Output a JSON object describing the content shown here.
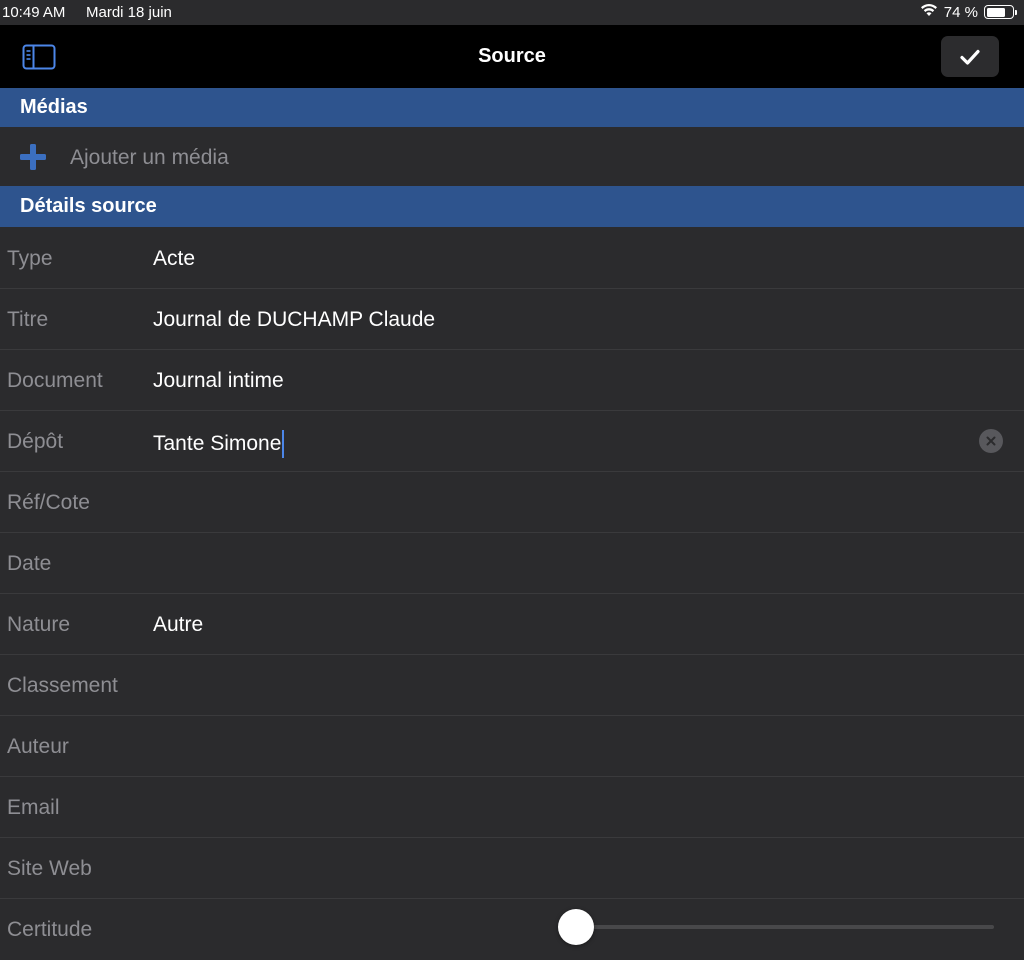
{
  "status_bar": {
    "time": "10:49 AM",
    "date": "Mardi 18 juin",
    "battery": "74 %",
    "battery_level": 74,
    "wifi_icon": "wifi-icon"
  },
  "nav": {
    "title": "Source",
    "sidebar_icon": "sidebar-icon",
    "done_icon": "checkmark-icon"
  },
  "media": {
    "header": "Médias",
    "add_label": "Ajouter un média",
    "add_icon": "plus-icon"
  },
  "details": {
    "header": "Détails source",
    "fields": [
      {
        "label": "Type",
        "value": "Acte"
      },
      {
        "label": "Titre",
        "value": "Journal de DUCHAMP Claude"
      },
      {
        "label": "Document",
        "value": "Journal intime"
      },
      {
        "label": "Dépôt",
        "value": "Tante Simone"
      },
      {
        "label": "Réf/Cote",
        "value": ""
      },
      {
        "label": "Date",
        "value": ""
      },
      {
        "label": "Nature",
        "value": "Autre"
      },
      {
        "label": "Classement",
        "value": ""
      },
      {
        "label": "Auteur",
        "value": ""
      },
      {
        "label": "Email",
        "value": ""
      },
      {
        "label": "Site Web",
        "value": ""
      },
      {
        "label": "Certitude",
        "value": ""
      }
    ],
    "certitude_level": 0
  },
  "colors": {
    "section_header_bg": "#2e548e",
    "background": "#2b2b2d",
    "navbar_bg": "#000000",
    "accent_caret": "#4c86e8",
    "plus_icon": "#3b6fc0"
  }
}
